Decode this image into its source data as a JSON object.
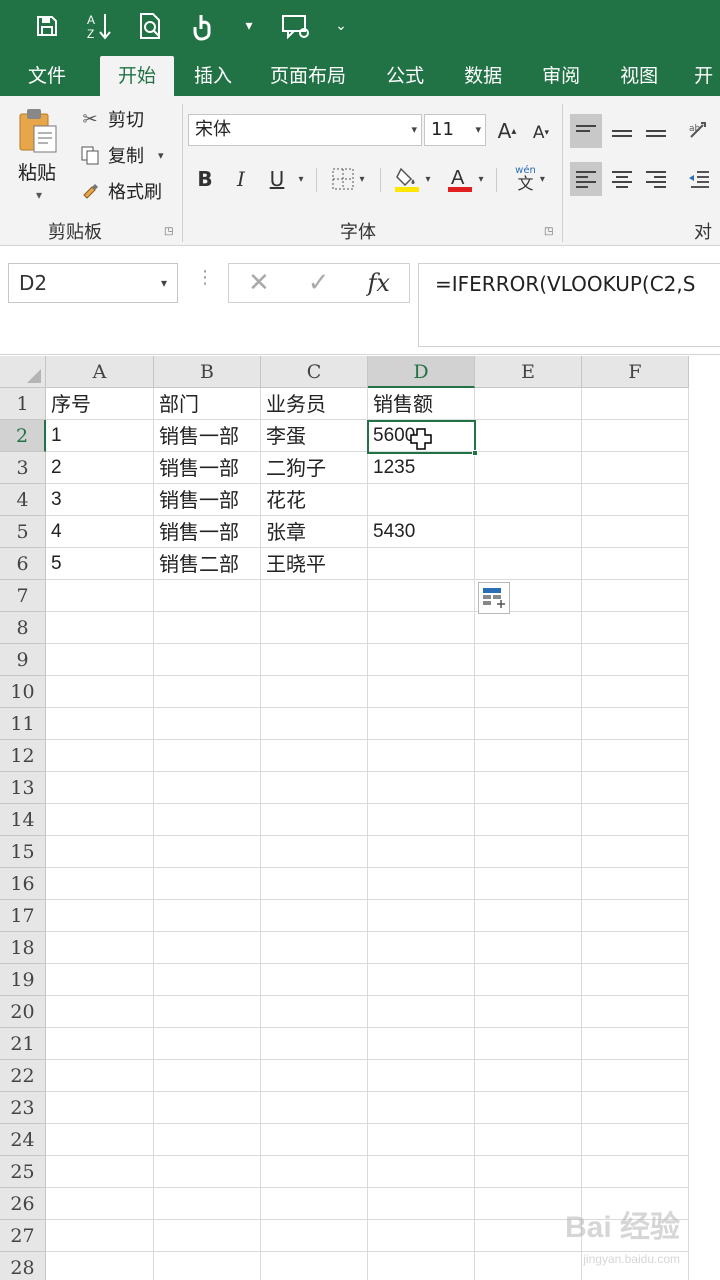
{
  "qat": {
    "items": [
      "save-icon",
      "sort-icon",
      "print-preview-icon",
      "touch-mode-icon",
      "comment-icon",
      "customize-icon"
    ],
    "dropdown_glyph": "▾",
    "customize_glyph": "⌄"
  },
  "tabs": [
    "文件",
    "开始",
    "插入",
    "页面布局",
    "公式",
    "数据",
    "审阅",
    "视图",
    "开"
  ],
  "active_tab": "开始",
  "ribbon": {
    "clipboard": {
      "paste": "粘贴",
      "cut": "剪切",
      "copy": "复制",
      "format_painter": "格式刷",
      "group_label": "剪贴板"
    },
    "font": {
      "font_name": "宋体",
      "font_size": "11",
      "grow": "A",
      "shrink": "A",
      "bold": "B",
      "italic": "I",
      "underline": "U",
      "group_label": "字体",
      "phonetic": "wén",
      "phonetic_char": "文"
    },
    "alignment": {
      "group_label": "对齐"
    }
  },
  "formula_bar": {
    "name_box": "D2",
    "cancel": "✕",
    "enter": "✓",
    "fx": "fx",
    "formula": "=IFERROR(VLOOKUP(C2,S"
  },
  "sheet": {
    "columns": [
      "A",
      "B",
      "C",
      "D",
      "E",
      "F"
    ],
    "selected_column": "D",
    "selected_cell": "D2",
    "rows": [
      {
        "n": "1",
        "cells": [
          "序号",
          "部门",
          "业务员",
          "销售额",
          "",
          ""
        ]
      },
      {
        "n": "2",
        "cells": [
          "1",
          "销售一部",
          "李蛋",
          "5600",
          "",
          ""
        ]
      },
      {
        "n": "3",
        "cells": [
          "2",
          "销售一部",
          "二狗子",
          "1235",
          "",
          ""
        ]
      },
      {
        "n": "4",
        "cells": [
          "3",
          "销售一部",
          "花花",
          "",
          "",
          ""
        ]
      },
      {
        "n": "5",
        "cells": [
          "4",
          "销售一部",
          "张章",
          "5430",
          "",
          ""
        ]
      },
      {
        "n": "6",
        "cells": [
          "5",
          "销售二部",
          "王晓平",
          "",
          "",
          ""
        ]
      },
      {
        "n": "7",
        "cells": [
          "",
          "",
          "",
          "",
          "",
          ""
        ]
      },
      {
        "n": "8",
        "cells": [
          "",
          "",
          "",
          "",
          "",
          ""
        ]
      },
      {
        "n": "9",
        "cells": [
          "",
          "",
          "",
          "",
          "",
          ""
        ]
      },
      {
        "n": "10",
        "cells": [
          "",
          "",
          "",
          "",
          "",
          ""
        ]
      },
      {
        "n": "11",
        "cells": [
          "",
          "",
          "",
          "",
          "",
          ""
        ]
      },
      {
        "n": "12",
        "cells": [
          "",
          "",
          "",
          "",
          "",
          ""
        ]
      },
      {
        "n": "13",
        "cells": [
          "",
          "",
          "",
          "",
          "",
          ""
        ]
      },
      {
        "n": "14",
        "cells": [
          "",
          "",
          "",
          "",
          "",
          ""
        ]
      },
      {
        "n": "15",
        "cells": [
          "",
          "",
          "",
          "",
          "",
          ""
        ]
      },
      {
        "n": "16",
        "cells": [
          "",
          "",
          "",
          "",
          "",
          ""
        ]
      },
      {
        "n": "17",
        "cells": [
          "",
          "",
          "",
          "",
          "",
          ""
        ]
      },
      {
        "n": "18",
        "cells": [
          "",
          "",
          "",
          "",
          "",
          ""
        ]
      },
      {
        "n": "19",
        "cells": [
          "",
          "",
          "",
          "",
          "",
          ""
        ]
      },
      {
        "n": "20",
        "cells": [
          "",
          "",
          "",
          "",
          "",
          ""
        ]
      },
      {
        "n": "21",
        "cells": [
          "",
          "",
          "",
          "",
          "",
          ""
        ]
      },
      {
        "n": "22",
        "cells": [
          "",
          "",
          "",
          "",
          "",
          ""
        ]
      },
      {
        "n": "23",
        "cells": [
          "",
          "",
          "",
          "",
          "",
          ""
        ]
      },
      {
        "n": "24",
        "cells": [
          "",
          "",
          "",
          "",
          "",
          ""
        ]
      },
      {
        "n": "25",
        "cells": [
          "",
          "",
          "",
          "",
          "",
          ""
        ]
      },
      {
        "n": "26",
        "cells": [
          "",
          "",
          "",
          "",
          "",
          ""
        ]
      },
      {
        "n": "27",
        "cells": [
          "",
          "",
          "",
          "",
          "",
          ""
        ]
      },
      {
        "n": "28",
        "cells": [
          "",
          "",
          "",
          "",
          "",
          ""
        ]
      }
    ]
  },
  "watermark": {
    "brand": "Bai 经验",
    "url": "jingyan.baidu.com"
  },
  "colors": {
    "excel_green": "#217346",
    "ribbon_bg": "#f3f3f3"
  }
}
